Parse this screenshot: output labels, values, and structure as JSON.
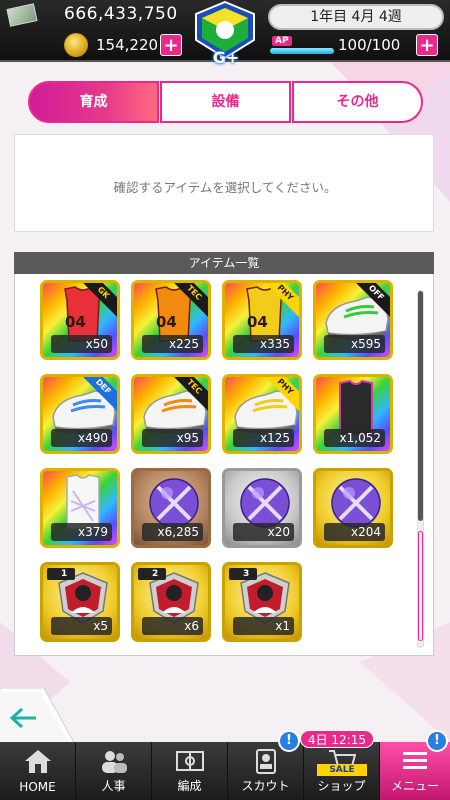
{
  "header": {
    "money": "666,433,750",
    "coins": "154,220",
    "rank_label": "G+",
    "date": "1年目 4月 4週",
    "ap_label": "AP",
    "ap_value": "100/100",
    "ap_fill": 1.0
  },
  "tabs": [
    {
      "label": "育成",
      "active": true
    },
    {
      "label": "設備",
      "active": false
    },
    {
      "label": "その他",
      "active": false
    }
  ],
  "message": "確認するアイテムを選択してください。",
  "list": {
    "header": "アイテム一覧",
    "items": [
      {
        "kind": "jersey-red",
        "tag": "GK",
        "count": "x50",
        "jersey_number": "04"
      },
      {
        "kind": "jersey-orange",
        "tag": "TEC",
        "count": "x225",
        "jersey_number": "04"
      },
      {
        "kind": "jersey-yellow",
        "tag": "PHY",
        "count": "x335",
        "jersey_number": "04"
      },
      {
        "kind": "boots-green",
        "tag": "OFF",
        "count": "x595"
      },
      {
        "kind": "boots-blue",
        "tag": "DEF",
        "count": "x490"
      },
      {
        "kind": "boots-orange",
        "tag": "TEC",
        "count": "x95"
      },
      {
        "kind": "boots-yellow",
        "tag": "PHY",
        "count": "x125"
      },
      {
        "kind": "vest-black",
        "tag": "",
        "count": "x1,052"
      },
      {
        "kind": "vest-white",
        "tag": "",
        "count": "x379"
      },
      {
        "kind": "ball-bronze",
        "tag": "",
        "count": "x6,285"
      },
      {
        "kind": "ball-silver",
        "tag": "",
        "count": "x20"
      },
      {
        "kind": "ball-gold",
        "tag": "",
        "count": "x204"
      },
      {
        "kind": "trainer-1",
        "tag": "1",
        "count": "x5"
      },
      {
        "kind": "trainer-2",
        "tag": "2",
        "count": "x6"
      },
      {
        "kind": "trainer-3",
        "tag": "3",
        "count": "x1"
      }
    ]
  },
  "nav": {
    "items": [
      {
        "label": "HOME",
        "icon": "home-icon"
      },
      {
        "label": "人事",
        "icon": "people-icon"
      },
      {
        "label": "編成",
        "icon": "field-icon"
      },
      {
        "label": "スカウト",
        "icon": "scout-icon"
      },
      {
        "label": "ショップ",
        "icon": "cart-icon"
      },
      {
        "label": "メニュー",
        "icon": "menu-icon"
      }
    ],
    "shop_time": "4日 12:15",
    "sale_label": "SALE",
    "notif_mark": "!"
  },
  "colors": {
    "accent": "#e92a8c",
    "notif": "#2a7de1"
  }
}
